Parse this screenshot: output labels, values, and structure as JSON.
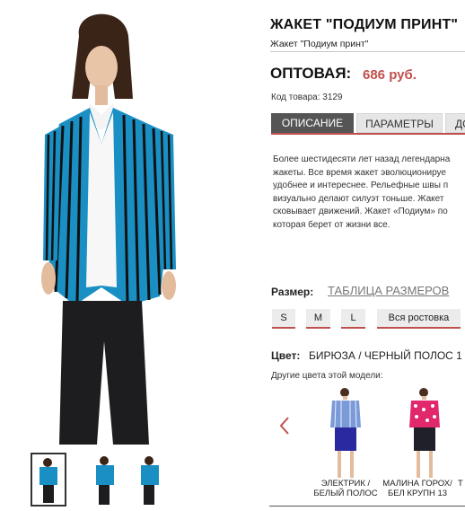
{
  "product": {
    "title": "ЖАКЕТ \"ПОДИУМ ПРИНТ\"",
    "subtitle": "Жакет \"Подиум принт\"",
    "price_label": "ОПТОВАЯ:",
    "price_value": "686 руб.",
    "sku": "Код товара: 3129"
  },
  "tabs": [
    {
      "label": "ОПИСАНИЕ",
      "active": true
    },
    {
      "label": "ПАРАМЕТРЫ",
      "active": false
    },
    {
      "label": "ДО",
      "active": false
    }
  ],
  "description_lines": [
    "Более шестидесяти лет назад легендарна",
    "жакеты. Все время жакет эволюционируе",
    "удобнее и интереснее. Рельефные швы п",
    "визуально делают силуэт тоньше. Жакет",
    "сковывает движений. Жакет «Подиум» по",
    "которая берет от жизни все."
  ],
  "size": {
    "label": "Размер:",
    "chart_link": "ТАБЛИЦА РАЗМЕРОВ",
    "options": [
      "S",
      "M",
      "L",
      "Вся ростовка"
    ]
  },
  "color": {
    "label": "Цвет:",
    "value": "БИРЮЗА / ЧЕРНЫЙ ПОЛОС 1",
    "other_label": "Другие цвета этой модели:",
    "variants": [
      {
        "name_line1": "ЭЛЕКТРИК /",
        "name_line2": "БЕЛЫЙ ПОЛОС",
        "jacket_color": "#7a9ad8",
        "skirt_color": "#2a2a9e"
      },
      {
        "name_line1": "МАЛИНА ГОРОХ/",
        "name_line2": "БЕЛ КРУПН 13",
        "jacket_color": "#e0286a",
        "skirt_color": "#20202a"
      }
    ],
    "partial_variant_label": "Т"
  },
  "thumbnails": [
    "thumb-front",
    "thumb-side",
    "thumb-back"
  ],
  "colors": {
    "accent": "#c0504d",
    "tab_active_bg": "#555555",
    "tab_inactive_bg": "#e6e6e6",
    "jacket_blue": "#1a8fc4"
  }
}
